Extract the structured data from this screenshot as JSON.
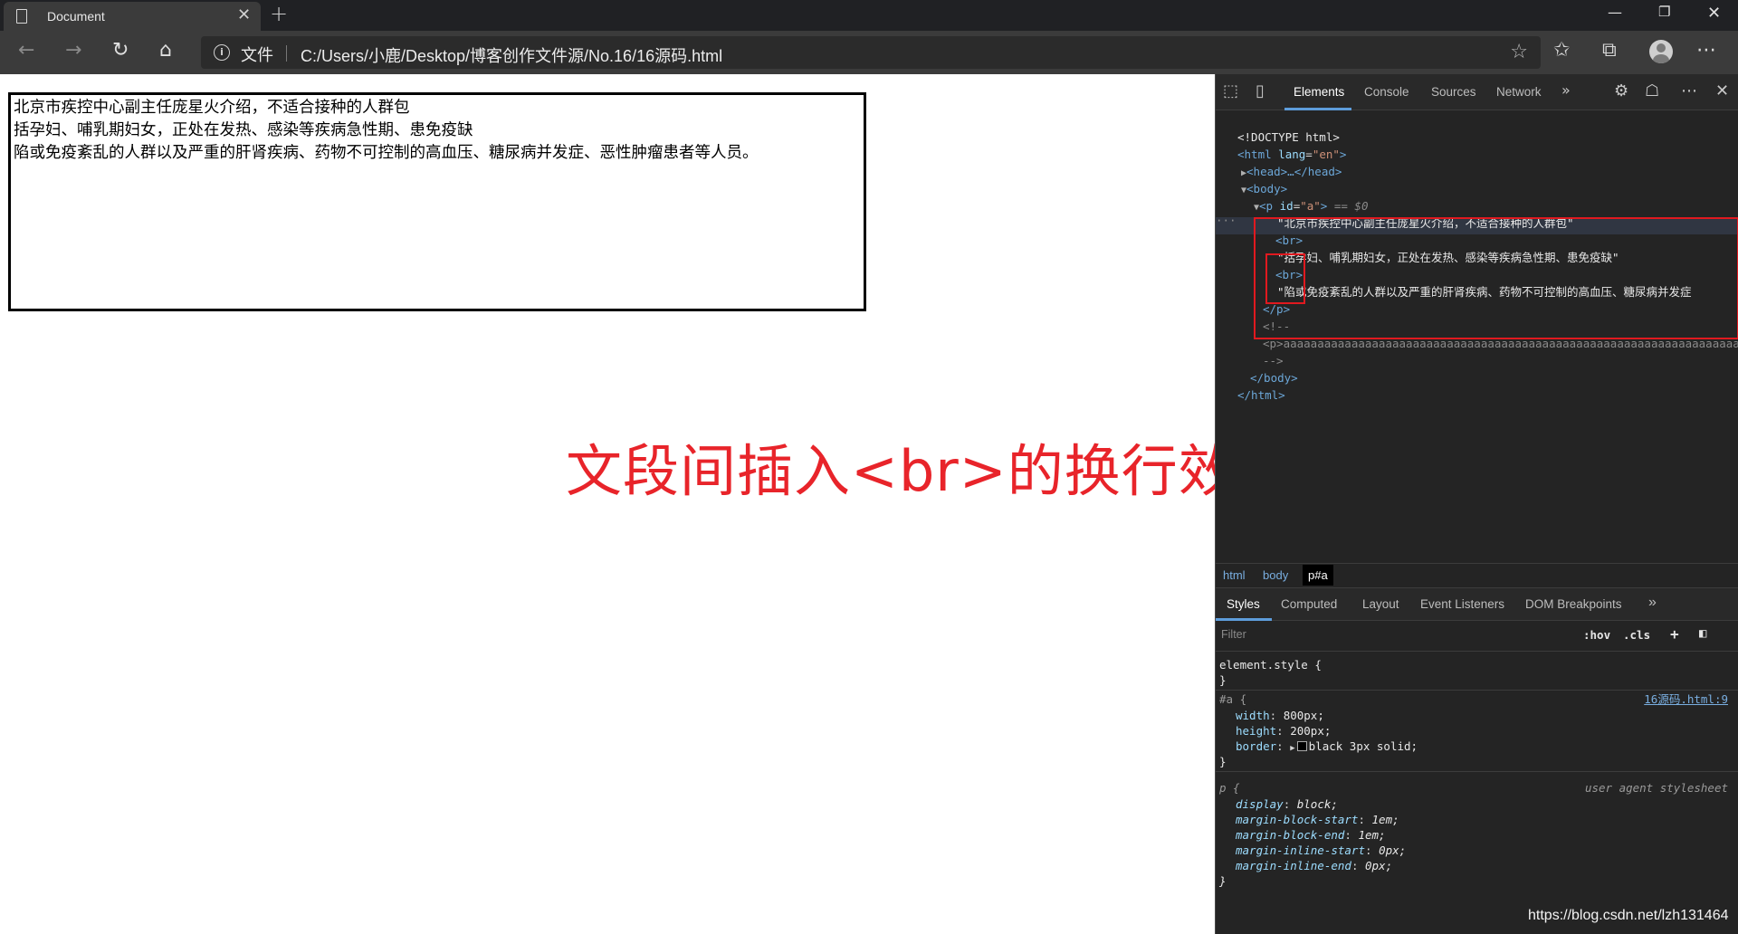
{
  "browser": {
    "tab_title": "Document",
    "address_prefix": "文件",
    "url": "C:/Users/小鹿/Desktop/博客创作文件源/No.16/16源码.html"
  },
  "page": {
    "paragraph_lines": [
      "北京市疾控中心副主任庞星火介绍，不适合接种的人群包",
      "括孕妇、哺乳期妇女，正处在发热、感染等疾病急性期、患免疫缺",
      "陷或免疫紊乱的人群以及严重的肝肾疾病、药物不可控制的高血压、糖尿病并发症、恶性肿瘤患者等人员。"
    ],
    "annotation": "文段间插入<br>的换行效果"
  },
  "devtools": {
    "tabs": [
      "Elements",
      "Console",
      "Sources",
      "Network"
    ],
    "dom": {
      "doctype": "<!DOCTYPE html>",
      "html_open": "<html",
      "lang_attr": "lang",
      "lang_val": "\"en\"",
      "head": "<head>…</head>",
      "body_open": "<body>",
      "p_open": "<p",
      "p_id_attr": "id",
      "p_id_val": "\"a\"",
      "eq0": "== $0",
      "text1": "\"北京市疾控中心副主任庞星火介绍，不适合接种的人群包\"",
      "br": "<br>",
      "text2": "\"括孕妇、哺乳期妇女，正处在发热、感染等疾病急性期、患免疫缺\"",
      "text3": "\"陷或免疫紊乱的人群以及严重的肝肾疾病、药物不可控制的高血压、糖尿病并发症",
      "p_close": "</p>",
      "comment_open": "<!--",
      "comment_body": "<p>aaaaaaaaaaaaaaaaaaaaaaaaaaaaaaaaaaaaaaaaaaaaaaaaaaaaaaaaaaaaaaaaaaaaaaaa",
      "comment_close": "-->",
      "body_close": "</body>",
      "html_close": "</html>",
      "ellipsis": "···"
    },
    "breadcrumbs": [
      "html",
      "body",
      "p#a"
    ],
    "styles_tabs": [
      "Styles",
      "Computed",
      "Layout",
      "Event Listeners",
      "DOM Breakpoints"
    ],
    "filter_placeholder": "Filter",
    "hov": ":hov",
    "cls": ".cls",
    "rules": {
      "element_style": "element.style {",
      "close": "}",
      "id_selector": "#a {",
      "id_source": "16源码.html:9",
      "width_prop": "width",
      "width_val": "800px;",
      "height_prop": "height",
      "height_val": "200px;",
      "border_prop": "border",
      "border_val": "black 3px solid;",
      "p_selector": "p {",
      "ua_label": "user agent stylesheet",
      "ua_props": [
        {
          "prop": "display",
          "val": "block;"
        },
        {
          "prop": "margin-block-start",
          "val": "1em;"
        },
        {
          "prop": "margin-block-end",
          "val": "1em;"
        },
        {
          "prop": "margin-inline-start",
          "val": "0px;"
        },
        {
          "prop": "margin-inline-end",
          "val": "0px;"
        }
      ]
    }
  },
  "watermark": "https://blog.csdn.net/lzh131464",
  "colors": {
    "annotation": "#e8242a",
    "highlight_box": "#e0191f",
    "devtools_bg": "#242424",
    "accent": "#5e9ddb"
  },
  "icons": [
    "page-icon",
    "close-icon",
    "plus-icon",
    "minimize-icon",
    "restore-icon",
    "back-arrow-icon",
    "forward-arrow-icon",
    "reload-icon",
    "home-icon",
    "info-icon",
    "star-icon",
    "favorites-icon",
    "collections-icon",
    "profile-icon",
    "more-icon",
    "inspect-icon",
    "device-icon",
    "gear-icon",
    "feedback-icon"
  ]
}
